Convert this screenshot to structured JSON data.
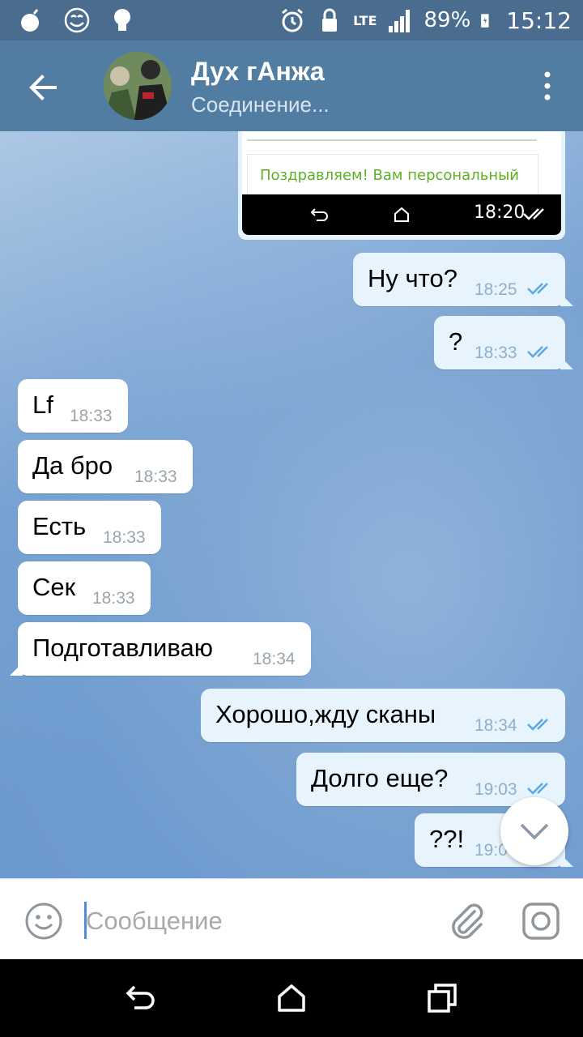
{
  "status_bar": {
    "battery": "89%",
    "time": "15:12",
    "network": "LTE"
  },
  "toolbar": {
    "title": "Дух гАнжа",
    "status": "Соединение..."
  },
  "image_message": {
    "caption": "Поздравляем! Вам персональный",
    "time": "18:20"
  },
  "messages": [
    {
      "text": "Ну что?",
      "time": "18:25",
      "direction": "out"
    },
    {
      "text": "?",
      "time": "18:33",
      "direction": "out"
    },
    {
      "text": "Lf",
      "time": "18:33",
      "direction": "in"
    },
    {
      "text": "Да бро",
      "time": "18:33",
      "direction": "in"
    },
    {
      "text": "Есть",
      "time": "18:33",
      "direction": "in"
    },
    {
      "text": "Сек",
      "time": "18:33",
      "direction": "in"
    },
    {
      "text": "Подготавливаю",
      "time": "18:34",
      "direction": "in"
    },
    {
      "text": "Хорошо,жду сканы",
      "time": "18:34",
      "direction": "out"
    },
    {
      "text": "Долго еще?",
      "time": "19:03",
      "direction": "out"
    },
    {
      "text": "??!",
      "time": "19:0",
      "direction": "out"
    }
  ],
  "input": {
    "placeholder": "Сообщение"
  },
  "colors": {
    "header": "#527da3",
    "outgoing_bubble": "#e7f3fd",
    "incoming_bubble": "#ffffff",
    "check_color": "#5ba8e0"
  }
}
